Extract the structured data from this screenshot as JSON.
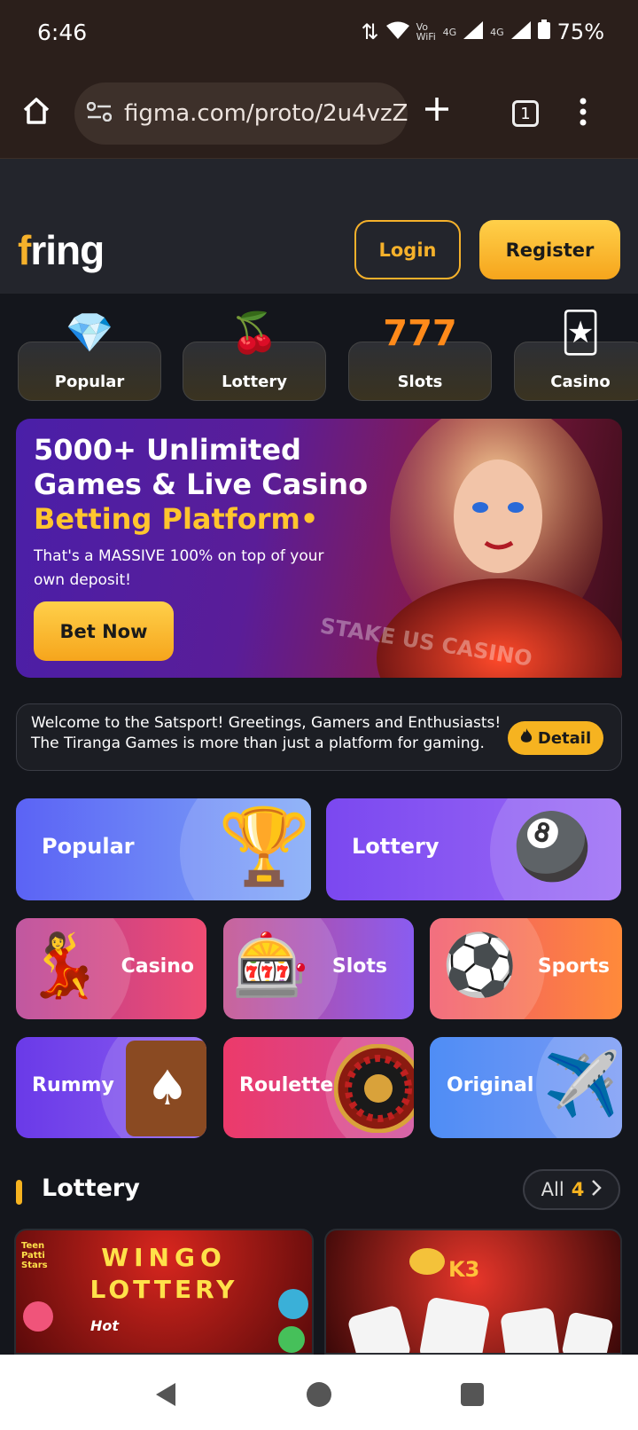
{
  "status_bar": {
    "time": "6:46",
    "network_small": "Vo WiFi",
    "net1": "4G",
    "net2": "4G",
    "battery": "75%"
  },
  "browser": {
    "url": "figma.com/proto/2u4vzZ",
    "tab_count": "1"
  },
  "header": {
    "logo_text": "ring",
    "logo_letter": "f",
    "login_label": "Login",
    "register_label": "Register"
  },
  "category_tabs": [
    {
      "label": "Popular",
      "icon": "fire-crystal-icon"
    },
    {
      "label": "Lottery",
      "icon": "cherry-icon"
    },
    {
      "label": "Slots",
      "icon": "777-icon"
    },
    {
      "label": "Casino",
      "icon": "cards-icon"
    }
  ],
  "banner": {
    "title_part1": "5000+ Unlimited Games & Live Casino ",
    "title_highlight": "Betting Platform",
    "subtitle": "That's a MASSIVE 100% on top of your own deposit!",
    "button_label": "Bet Now",
    "art_text": "STAKE US CASINO"
  },
  "notice": {
    "text": "Welcome to the Satsport!  Greetings, Gamers and Enthusiasts! The Tiranga Games is more than just a platform for gaming.",
    "detail_label": "Detail"
  },
  "tiles": {
    "popular": "Popular",
    "lottery": "Lottery",
    "casino": "Casino",
    "slots": "Slots",
    "sports": "Sports",
    "rummy": "Rummy",
    "roulette": "Roulette",
    "original": "Original"
  },
  "lottery_section": {
    "title": "Lottery",
    "all_label": "All",
    "all_count": "4"
  },
  "game_cards": [
    {
      "title_line1": "WINGO",
      "title_line2": "LOTTERY",
      "badge": "Hot",
      "corner": "Teen Patti Stars"
    },
    {
      "title": "K3"
    }
  ],
  "colors": {
    "accent": "#f6b320",
    "background": "#14161c"
  }
}
